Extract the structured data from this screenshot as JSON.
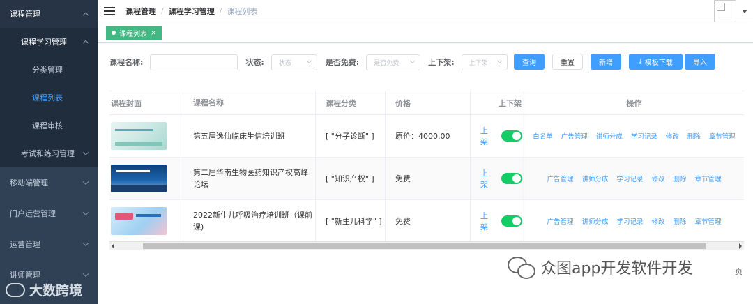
{
  "sidebar": {
    "items": [
      {
        "label": "课程管理",
        "kind": "top",
        "chevron": "up"
      },
      {
        "label": "课程学习管理",
        "kind": "sub",
        "chevron": "up"
      },
      {
        "label": "分类管理",
        "kind": "leaf"
      },
      {
        "label": "课程列表",
        "kind": "leaf",
        "active": true
      },
      {
        "label": "课程审核",
        "kind": "leaf"
      },
      {
        "label": "考试和练习管理",
        "kind": "sub2",
        "chevron": "down"
      },
      {
        "label": "移动端管理",
        "kind": "top2",
        "chevron": "down"
      },
      {
        "label": "门户运营管理",
        "kind": "top2",
        "chevron": "down"
      },
      {
        "label": "运营管理",
        "kind": "top2",
        "chevron": "down"
      },
      {
        "label": "讲师管理",
        "kind": "top2",
        "chevron": "down"
      }
    ]
  },
  "header": {
    "breadcrumb": [
      "课程管理",
      "课程学习管理",
      "课程列表"
    ]
  },
  "tags": {
    "active": "课程列表",
    "close": "×"
  },
  "search": {
    "name_label": "课程名称:",
    "name_placeholder": "",
    "status_label": "状态:",
    "status_placeholder": "状态",
    "free_label": "是否免费:",
    "free_placeholder": "是否免费",
    "shelf_label": "上下架:",
    "shelf_placeholder": "上下架",
    "query_button": "查询",
    "reset_button": "重置",
    "add_button": "新增",
    "template_button": "模板下载",
    "import_button": "导入"
  },
  "table": {
    "columns": [
      "课程封面",
      "课程名称",
      "课程分类",
      "价格",
      "上下架",
      "操作"
    ],
    "rows": [
      {
        "name": "第五届逸仙临床生信培训班",
        "category": "[ \"分子诊断\" ]",
        "price": "原价：4000.00",
        "shelf": "上架",
        "shelf_on": true,
        "actions": [
          "白名单",
          "广告管理",
          "讲师分成",
          "学习记录",
          "修改",
          "删除",
          "章节管理"
        ]
      },
      {
        "name": "第二届华南生物医药知识产权高峰论坛",
        "category": "[ \"知识产权\" ]",
        "price": "免费",
        "shelf": "上架",
        "shelf_on": true,
        "actions": [
          "广告管理",
          "讲师分成",
          "学习记录",
          "修改",
          "删除",
          "章节管理"
        ]
      },
      {
        "name": "2022新生儿呼吸治疗培训班（课前课)",
        "category": "[ \"新生儿科学\" ]",
        "price": "免费",
        "shelf": "上架",
        "shelf_on": true,
        "actions": [
          "广告管理",
          "讲师分成",
          "学习记录",
          "修改",
          "删除",
          "章节管理"
        ]
      }
    ]
  },
  "pagination": {
    "tail": "页"
  },
  "watermarks": {
    "bottom_left": "大数跨境",
    "bottom_right": "众图app开发软件开发"
  },
  "colors": {
    "sidebar_bg": "#304156",
    "primary": "#409eff",
    "switch_on": "#13ce66",
    "tag_active": "#42b983"
  }
}
